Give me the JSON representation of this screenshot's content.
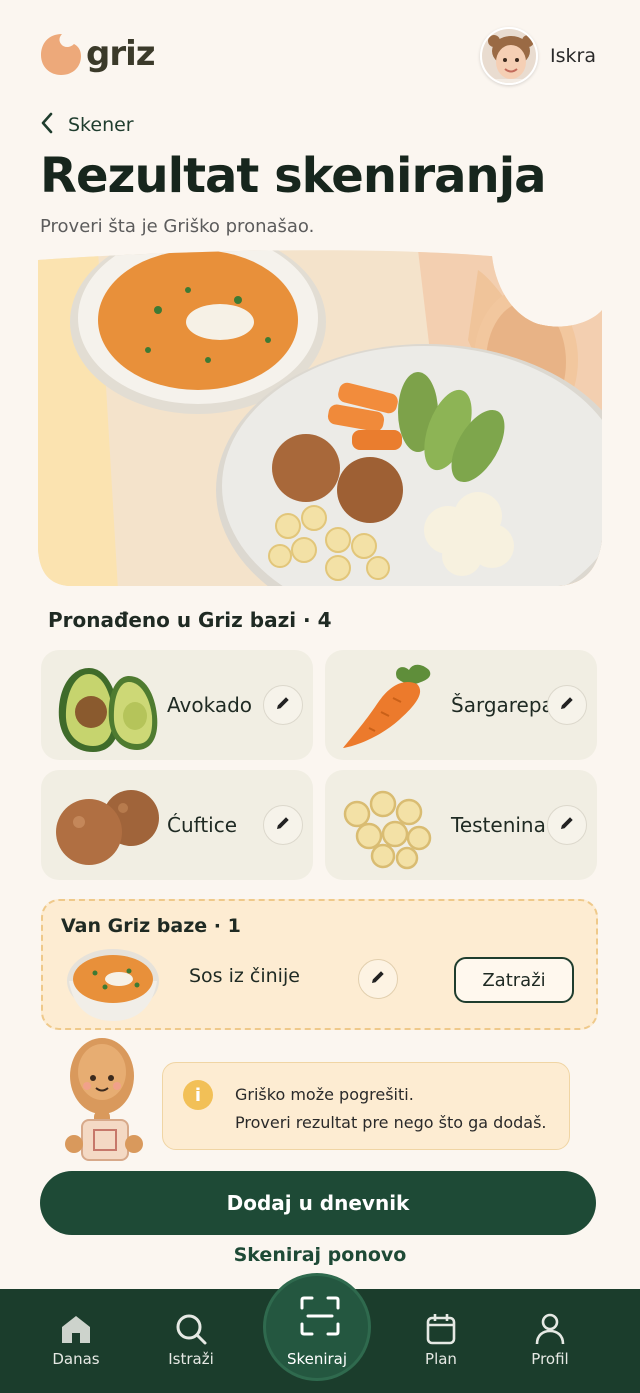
{
  "app": {
    "logo_text": "griz"
  },
  "profile": {
    "name": "Iskra"
  },
  "nav_back": {
    "label": "Skener"
  },
  "page": {
    "title": "Rezultat skeniranja",
    "subtitle": "Proveri šta je Griško pronašao."
  },
  "found": {
    "title": "Pronađeno u Griz bazi · 4",
    "items": [
      {
        "name": "Avokado",
        "icon": "avocado-icon"
      },
      {
        "name": "Šargarepa",
        "icon": "carrot-icon"
      },
      {
        "name": "Ćuftice",
        "icon": "meatballs-icon"
      },
      {
        "name": "Testenina",
        "icon": "pasta-icon"
      }
    ]
  },
  "outside": {
    "title": "Van Griz baze · 1",
    "item": {
      "name": "Sos iz činije",
      "icon": "sauce-bowl-icon"
    },
    "request_label": "Zatraži"
  },
  "notice": {
    "line1": "Griško može pogrešiti.",
    "line2": "Proveri rezultat pre nego što ga dodaš."
  },
  "actions": {
    "primary": "Dodaj u dnevnik",
    "secondary": "Skeniraj ponovo"
  },
  "bottom_nav": [
    {
      "label": "Danas",
      "icon": "home-icon"
    },
    {
      "label": "Istraži",
      "icon": "search-icon"
    },
    {
      "label": "Skeniraj",
      "icon": "scan-icon"
    },
    {
      "label": "Plan",
      "icon": "calendar-icon"
    },
    {
      "label": "Profil",
      "icon": "user-icon"
    }
  ],
  "colors": {
    "background": "#fbf6f0",
    "primary": "#1e4a36",
    "nav": "#1b3d2c",
    "card": "#f1eee3",
    "warning_bg": "#fdecd2",
    "logo": "#eda97a"
  }
}
